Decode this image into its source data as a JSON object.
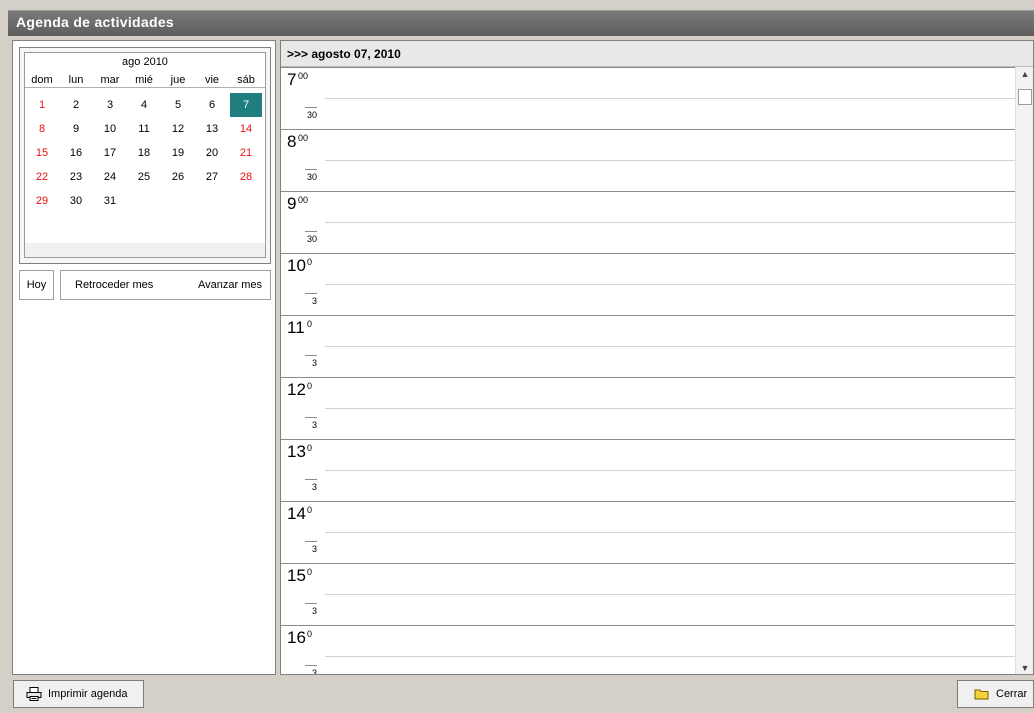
{
  "window": {
    "title": "Agenda de actividades"
  },
  "calendar": {
    "month_label": "ago 2010",
    "weekdays": [
      "dom",
      "lun",
      "mar",
      "mié",
      "jue",
      "vie",
      "sáb"
    ],
    "weeks": [
      [
        "1",
        "2",
        "3",
        "4",
        "5",
        "6",
        "7"
      ],
      [
        "8",
        "9",
        "10",
        "11",
        "12",
        "13",
        "14"
      ],
      [
        "15",
        "16",
        "17",
        "18",
        "19",
        "20",
        "21"
      ],
      [
        "22",
        "23",
        "24",
        "25",
        "26",
        "27",
        "28"
      ],
      [
        "29",
        "30",
        "31",
        "",
        "",
        "",
        ""
      ]
    ],
    "selected_day": "7",
    "weekend_color": "#ee1111",
    "selected_color": "#1f7f7f"
  },
  "calendar_buttons": {
    "today": "Hoy",
    "prev": "Retroceder mes",
    "next": "Avanzar mes"
  },
  "schedule": {
    "date_header": ">>> agosto 07, 2010",
    "hours": [
      {
        "hour": "7",
        "sup": "00",
        "half": "30"
      },
      {
        "hour": "8",
        "sup": "00",
        "half": "30"
      },
      {
        "hour": "9",
        "sup": "00",
        "half": "30"
      },
      {
        "hour": "10",
        "sup": "0",
        "half": "3"
      },
      {
        "hour": "11",
        "sup": "0",
        "half": "3"
      },
      {
        "hour": "12",
        "sup": "0",
        "half": "3"
      },
      {
        "hour": "13",
        "sup": "0",
        "half": "3"
      },
      {
        "hour": "14",
        "sup": "0",
        "half": "3"
      },
      {
        "hour": "15",
        "sup": "0",
        "half": "3"
      },
      {
        "hour": "16",
        "sup": "0",
        "half": "3"
      }
    ]
  },
  "footer": {
    "print_label": "Imprimir agenda",
    "close_label": "Cerrar"
  },
  "icons": {
    "print": "printer-icon",
    "close": "folder-icon",
    "scroll_up": "arrow-up-icon",
    "scroll_down": "arrow-down-icon"
  }
}
